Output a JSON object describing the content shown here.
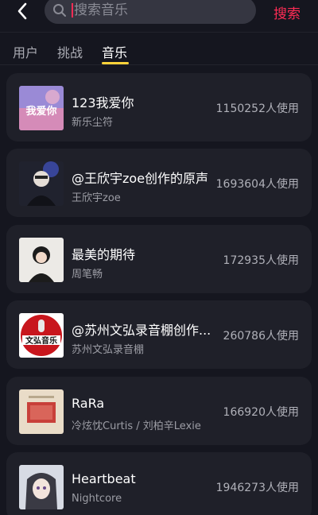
{
  "search": {
    "placeholder": "搜索音乐",
    "submit_label": "搜索"
  },
  "tabs": [
    {
      "label": "用户"
    },
    {
      "label": "挑战"
    },
    {
      "label": "音乐",
      "active": true
    }
  ],
  "songs": [
    {
      "title": "123我爱你",
      "artist": "新乐尘符",
      "uses": "1150252人使用",
      "cover_text": "我爱你"
    },
    {
      "title": "@王欣宇zoe创作的原声",
      "artist": "王欣宇zoe",
      "uses": "1693604人使用"
    },
    {
      "title": "最美的期待",
      "artist": "周笔畅",
      "uses": "172935人使用"
    },
    {
      "title": "@苏州文弘录音棚创作...",
      "artist": "苏州文弘录音棚",
      "uses": "260786人使用",
      "cover_text": "文弘音乐"
    },
    {
      "title": "RaRa",
      "artist": "冷炫忱Curtis / 刘柏辛Lexie",
      "uses": "166920人使用"
    },
    {
      "title": "Heartbeat",
      "artist": "Nightcore",
      "uses": "1946273人使用"
    }
  ],
  "colors": {
    "accent": "#fe2c55",
    "tab_indicator": "#fdd23a",
    "card": "#1f2029",
    "background": "#15161f"
  }
}
